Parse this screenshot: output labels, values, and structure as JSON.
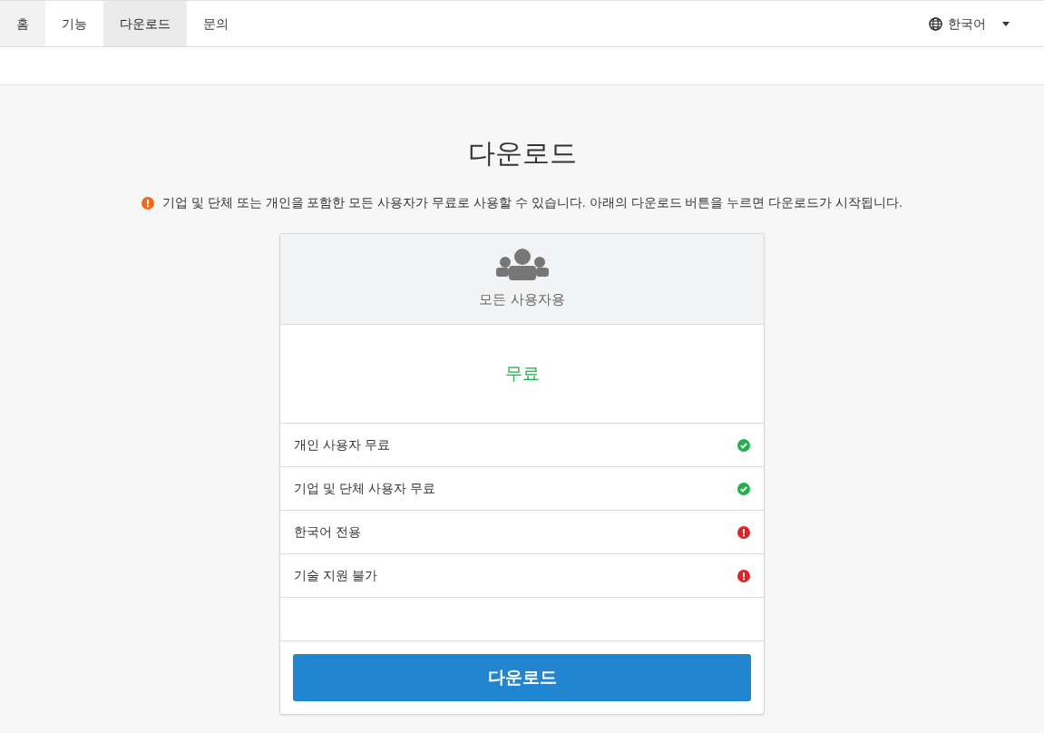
{
  "nav": {
    "items": [
      {
        "label": "홈",
        "highlighted": true,
        "selected": false
      },
      {
        "label": "기능",
        "highlighted": false,
        "selected": false
      },
      {
        "label": "다운로드",
        "highlighted": false,
        "selected": true
      },
      {
        "label": "문의",
        "highlighted": false,
        "selected": false
      }
    ],
    "language": "한국어"
  },
  "page": {
    "title": "다운로드",
    "notice": "기업 및 단체 또는 개인을 포함한 모든 사용자가 무료로 사용할 수 있습니다. 아래의 다운로드 버튼을 누르면 다운로드가 시작됩니다."
  },
  "plan": {
    "audience": "모든 사용자용",
    "price": "무료",
    "features": [
      {
        "label": "개인 사용자 무료",
        "kind": "yes"
      },
      {
        "label": "기업 및 단체 사용자 무료",
        "kind": "yes"
      },
      {
        "label": "한국어 전용",
        "kind": "no"
      },
      {
        "label": "기술 지원 불가",
        "kind": "no"
      }
    ],
    "button": "다운로드"
  }
}
